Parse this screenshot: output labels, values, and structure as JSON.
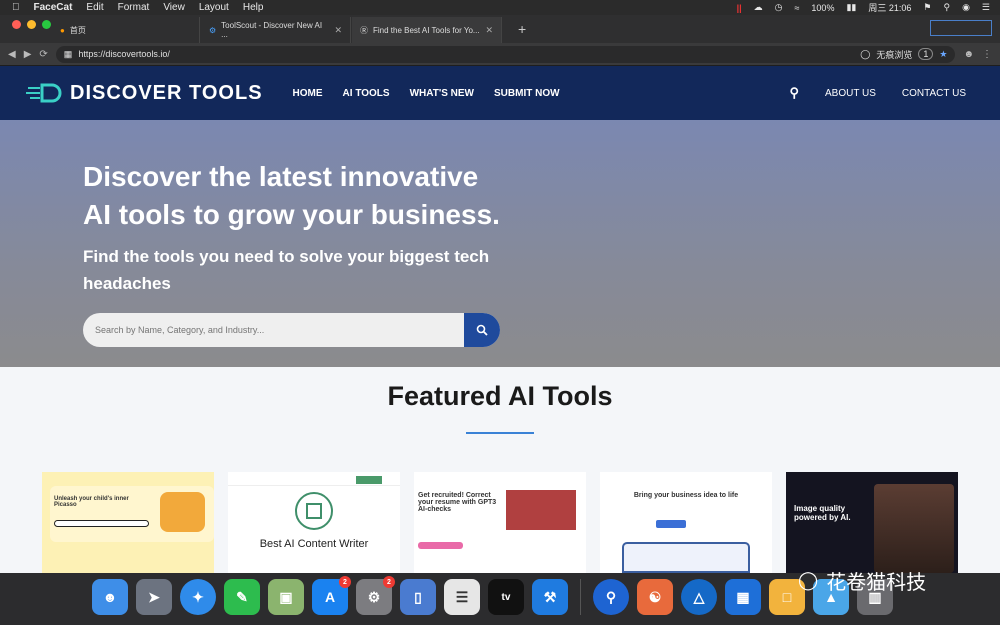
{
  "menubar": {
    "app": "FaceCat",
    "items": [
      "Edit",
      "Format",
      "View",
      "Layout",
      "Help"
    ],
    "battery": "100%",
    "clock": "周三 21:06"
  },
  "tabs": [
    {
      "label": "首页"
    },
    {
      "label": "ToolScout - Discover New AI ..."
    },
    {
      "label": "Find the Best AI Tools for Yo..."
    }
  ],
  "address": {
    "url": "https://discovertools.io/",
    "incognito": "无痕浏览",
    "count": "1"
  },
  "site": {
    "logo": "DISCOVER TOOLS",
    "nav": [
      "HOME",
      "AI TOOLS",
      "WHAT'S NEW",
      "SUBMIT NOW"
    ],
    "nav_right": [
      "ABOUT US",
      "CONTACT US"
    ]
  },
  "hero": {
    "title": "Discover the latest innovative AI tools to grow your business.",
    "subtitle": "Find the tools you need to solve your biggest tech headaches",
    "search_placeholder": "Search by Name, Category, and Industry..."
  },
  "featured": {
    "title": "Featured AI Tools",
    "cards": [
      {
        "caption": "Unleash your child's inner Picasso"
      },
      {
        "caption": "Best AI Content Writer"
      },
      {
        "caption": "Get recruited! Correct your resume with GPT3 AI-checks"
      },
      {
        "caption": "Bring your business idea to life"
      },
      {
        "caption": "Image quality powered by AI."
      }
    ]
  },
  "dock": {
    "badges": [
      "2",
      "2"
    ],
    "tv_label": "tv"
  },
  "watermark": "花卷猫科技",
  "colors": {
    "header_bg": "#12285a",
    "search_button": "#1f4a9c",
    "accent_rule": "#3a82d6"
  }
}
